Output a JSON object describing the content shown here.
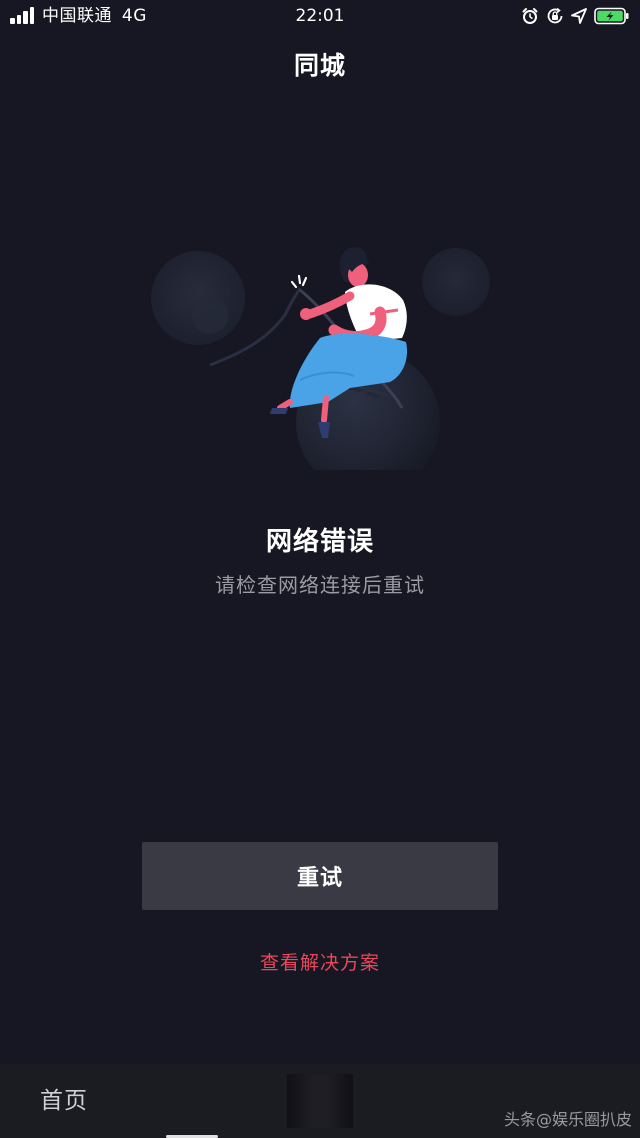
{
  "status_bar": {
    "carrier": "中国联通",
    "network": "4G",
    "time": "22:01",
    "icons": [
      "signal-icon",
      "alarm-icon",
      "orientation-lock-icon",
      "location-icon",
      "battery-icon"
    ],
    "battery_color": "#4cd964"
  },
  "nav": {
    "title": "同城"
  },
  "error": {
    "title": "网络错误",
    "subtitle": "请检查网络连接后重试"
  },
  "actions": {
    "retry_label": "重试",
    "solution_label": "查看解决方案",
    "accent_color": "#e8475c"
  },
  "tab_bar": {
    "home_label": "首页"
  },
  "watermark": "头条@娱乐圈扒皮"
}
